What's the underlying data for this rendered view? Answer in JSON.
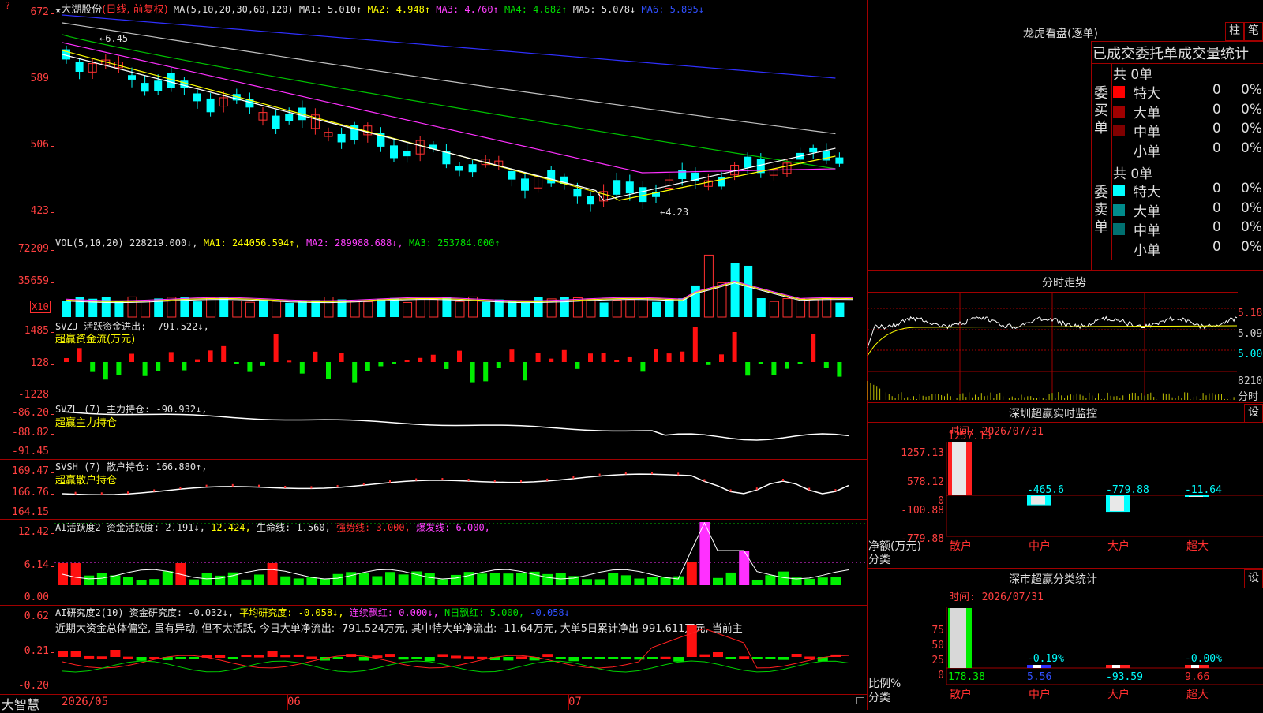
{
  "app_name": "大智慧",
  "stock_header": {
    "star": "★",
    "name": "大湖股份",
    "period": "(日线, 前复权)",
    "ma_def": "MA(5,10,20,30,60,120)",
    "ma1": "MA1: 5.010↑",
    "ma2": "MA2: 4.948↑",
    "ma3": "MA3: 4.760↑",
    "ma4": "MA4: 4.682↑",
    "ma5": "MA5: 5.078↓",
    "ma6": "MA6: 5.895↓",
    "top_marker": "?"
  },
  "price_axis": [
    "672",
    "589",
    "506",
    "423"
  ],
  "price_annotations": {
    "high": "6.45",
    "low": "←4.23"
  },
  "vol_panel": {
    "title": "VOL(5,10,20)",
    "value": "228219.000↓,",
    "ma1": "MA1: 244056.594↑,",
    "ma2": "MA2: 289988.688↓,",
    "ma3": "MA3: 253784.000↑",
    "axis": [
      "72209",
      "35659",
      "X10"
    ]
  },
  "svzj_panel": {
    "title": "SVZJ  活跃资金进出: -791.522↓,",
    "subtitle": "超赢资金流(万元)",
    "axis": [
      "1485",
      "128",
      "-1228"
    ]
  },
  "svzl_panel": {
    "title": "SVZL (7) 主力持仓: -90.932↓,",
    "subtitle": "超赢主力持仓",
    "axis": [
      "-86.20",
      "-88.82",
      "-91.45"
    ]
  },
  "svsh_panel": {
    "title": "SVSH (7) 散户持仓: 166.880↑,",
    "subtitle": "超赢散户持仓",
    "axis": [
      "169.47",
      "166.76",
      "164.15"
    ]
  },
  "ai_active_panel": {
    "label": "AI活跃度2",
    "v1": "资金活跃度: 2.191↓,",
    "v2": "12.424,",
    "v3": "生命线: 1.560,",
    "v4": "强势线: 3.000,",
    "v5": "爆发线: 6.000,",
    "axis": [
      "12.42",
      "6.14",
      "0.00"
    ]
  },
  "ai_research_panel": {
    "label": "AI研究度2(10)",
    "v1": "资金研究度: -0.032↓,",
    "v2": "平均研究度: -0.058↓,",
    "v3": "连续飘红: 0.000↓,",
    "v4": "N日飘红: 5.000,",
    "v5": "-0.058↓",
    "comment": "近期大资金总体偏空, 虽有异动, 但不太活跃, 今日大单净流出: -791.524万元, 其中特大单净流出: -11.64万元, 大单5日累计净出-991.611万元, 当前主",
    "axis": [
      "0.62",
      "0.21",
      "-0.20"
    ]
  },
  "date_axis": [
    "2026/05",
    "06",
    "07"
  ],
  "longhu": {
    "title": "龙虎看盘(逐单)",
    "btn_bar": "柱",
    "btn_pen": "笔",
    "header": "已成交委托单成交量统计",
    "buy_label": "委买单",
    "sell_label": "委卖单",
    "buy_total": "共 0单",
    "sell_total": "共 0单",
    "rows": [
      {
        "name": "特大",
        "count": "0",
        "pct": "0%"
      },
      {
        "name": "大单",
        "count": "0",
        "pct": "0%"
      },
      {
        "name": "中单",
        "count": "0",
        "pct": "0%"
      },
      {
        "name": "小单",
        "count": "0",
        "pct": "0%"
      }
    ],
    "colors_buy": [
      "#ff0000",
      "#a00000",
      "#800000",
      "#000000"
    ],
    "colors_sell": [
      "#00ffff",
      "#008b8b",
      "#007070",
      "#000000"
    ]
  },
  "intraday": {
    "title": "分时走势",
    "axis": [
      "5.180",
      "5.090",
      "5.000",
      "8210"
    ],
    "vol_label": "分时"
  },
  "sz_monitor": {
    "title": "深圳超赢实时监控",
    "set_btn": "设",
    "time": "时间: 2026/07/31",
    "axis": [
      "1257.13",
      "578.12",
      "0",
      "-100.88",
      "-779.88"
    ],
    "axis_label": "净额(万元)",
    "cat_label": "分类",
    "bars": [
      {
        "name": "散户",
        "value": 1257.13,
        "label": "1257.13"
      },
      {
        "name": "中户",
        "value": -465.6,
        "label": "-465.6"
      },
      {
        "name": "大户",
        "value": -779.88,
        "label": "-779.88"
      },
      {
        "name": "超大",
        "value": -11.64,
        "label": "-11.64"
      }
    ]
  },
  "sz_class": {
    "title": "深市超赢分类统计",
    "set_btn": "设",
    "time": "时间: 2026/07/31",
    "axis": [
      "75",
      "50",
      "25",
      "0"
    ],
    "axis_label": "比例%",
    "cat_label": "分类",
    "bars": [
      {
        "name": "散户",
        "pct": 80,
        "label": "178.38"
      },
      {
        "name": "中户",
        "pct": -0.19,
        "label": "5.56",
        "top": "-0.19%"
      },
      {
        "name": "大户",
        "pct": 0,
        "label": "-93.59"
      },
      {
        "name": "超大",
        "pct": 0,
        "label": "9.66",
        "top": "-0.00%"
      }
    ]
  }
}
